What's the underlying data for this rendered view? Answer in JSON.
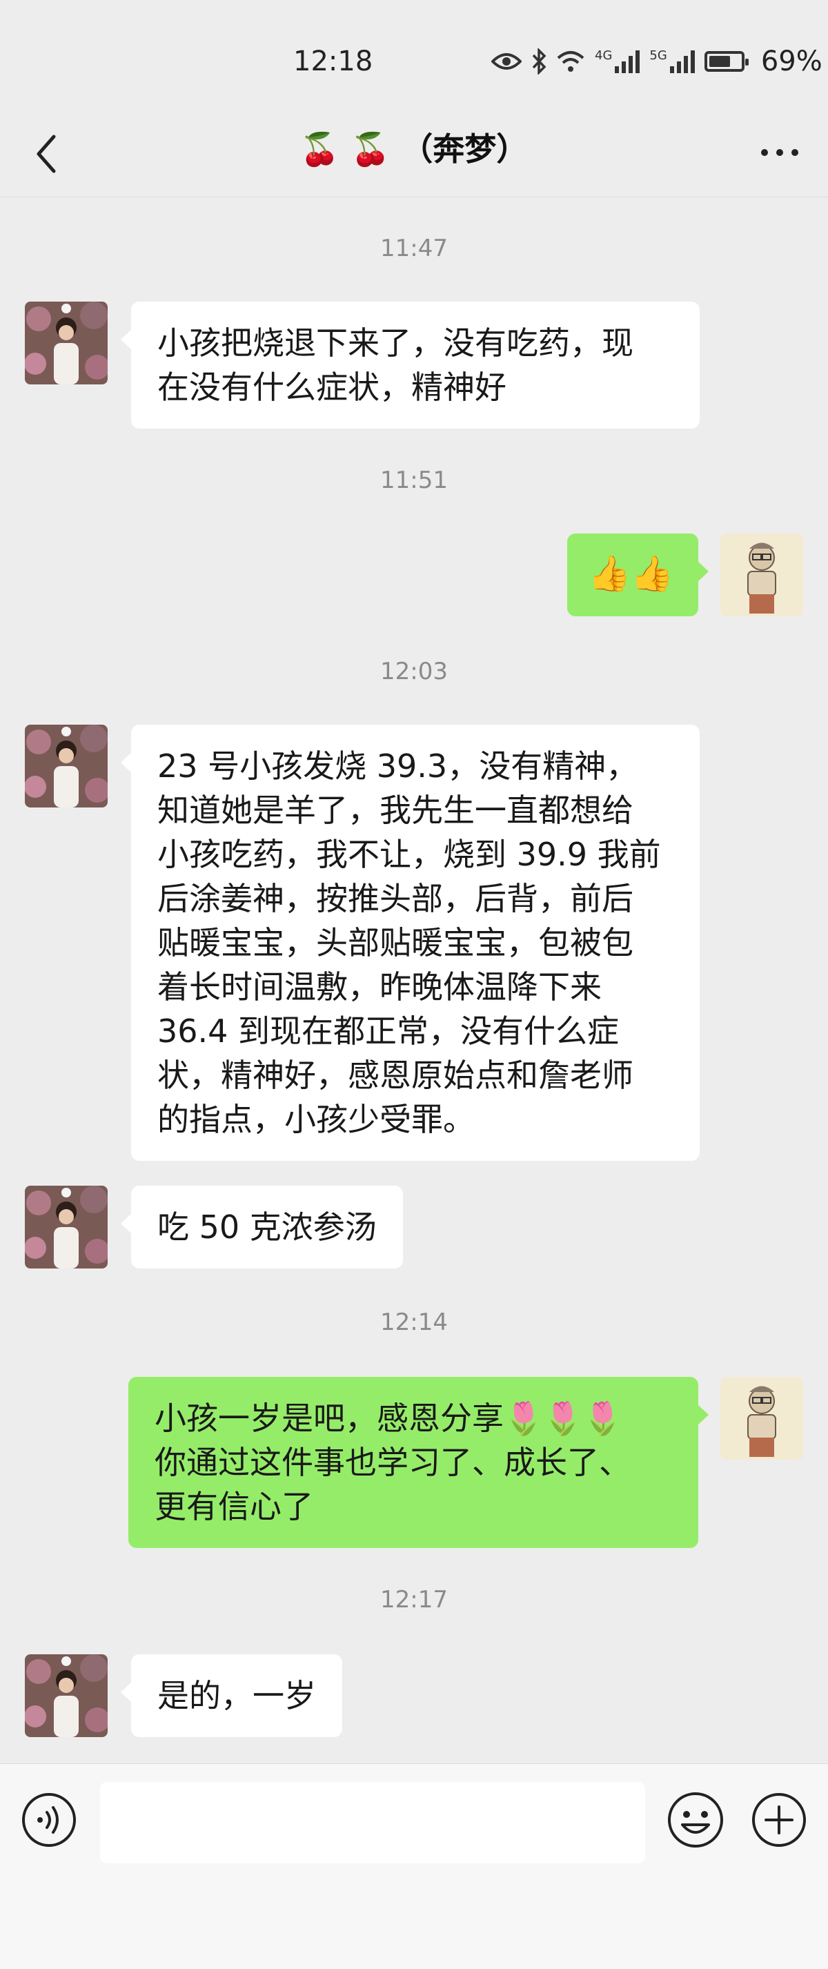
{
  "status_bar": {
    "time": "12:18",
    "network_1": "4G",
    "network_2": "5G",
    "battery_percent": "69%",
    "battery_level": 0.69,
    "icons": [
      "eye-icon",
      "bluetooth-icon",
      "wifi-icon",
      "signal-icon",
      "signal-icon",
      "battery-icon"
    ]
  },
  "nav": {
    "title_emoji": "🍒 🍒",
    "title_name": "（奔梦）",
    "back_icon": "chevron-left-icon",
    "more_icon": "more-dots-icon"
  },
  "messages": [
    {
      "type": "time",
      "text": "11:47"
    },
    {
      "type": "in",
      "lines": [
        "小孩把烧退下来了，没有吃药，现",
        "在没有什么症状，精神好"
      ]
    },
    {
      "type": "time",
      "text": "11:51"
    },
    {
      "type": "out",
      "text": "👍👍"
    },
    {
      "type": "time",
      "text": "12:03"
    },
    {
      "type": "in",
      "lines": [
        "23 号小孩发烧 39.3，没有精神，",
        "知道她是羊了，我先生一直都想给",
        "小孩吃药，我不让，烧到 39.9 我前",
        "后涂姜神，按推头部，后背，前后",
        "贴暖宝宝，头部贴暖宝宝，包被包",
        "着长时间温敷，昨晚体温降下来",
        "36.4 到现在都正常，没有什么症",
        "状，精神好，感恩原始点和詹老师",
        "的指点，小孩少受罪。"
      ]
    },
    {
      "type": "in",
      "text": "吃 50 克浓参汤"
    },
    {
      "type": "time",
      "text": "12:14"
    },
    {
      "type": "out",
      "lines": [
        "小孩一岁是吧，感恩分享🌷🌷🌷",
        "你通过这件事也学习了、成长了、",
        "更有信心了"
      ]
    },
    {
      "type": "time",
      "text": "12:17"
    },
    {
      "type": "in",
      "text": "是的，一岁"
    }
  ],
  "input_bar": {
    "placeholder": "",
    "voice_icon": "voice-icon",
    "emoji_icon": "emoji-icon",
    "plus_icon": "plus-icon"
  },
  "colors": {
    "background": "#ededed",
    "bubble_in": "#ffffff",
    "bubble_out": "#95ec69"
  }
}
